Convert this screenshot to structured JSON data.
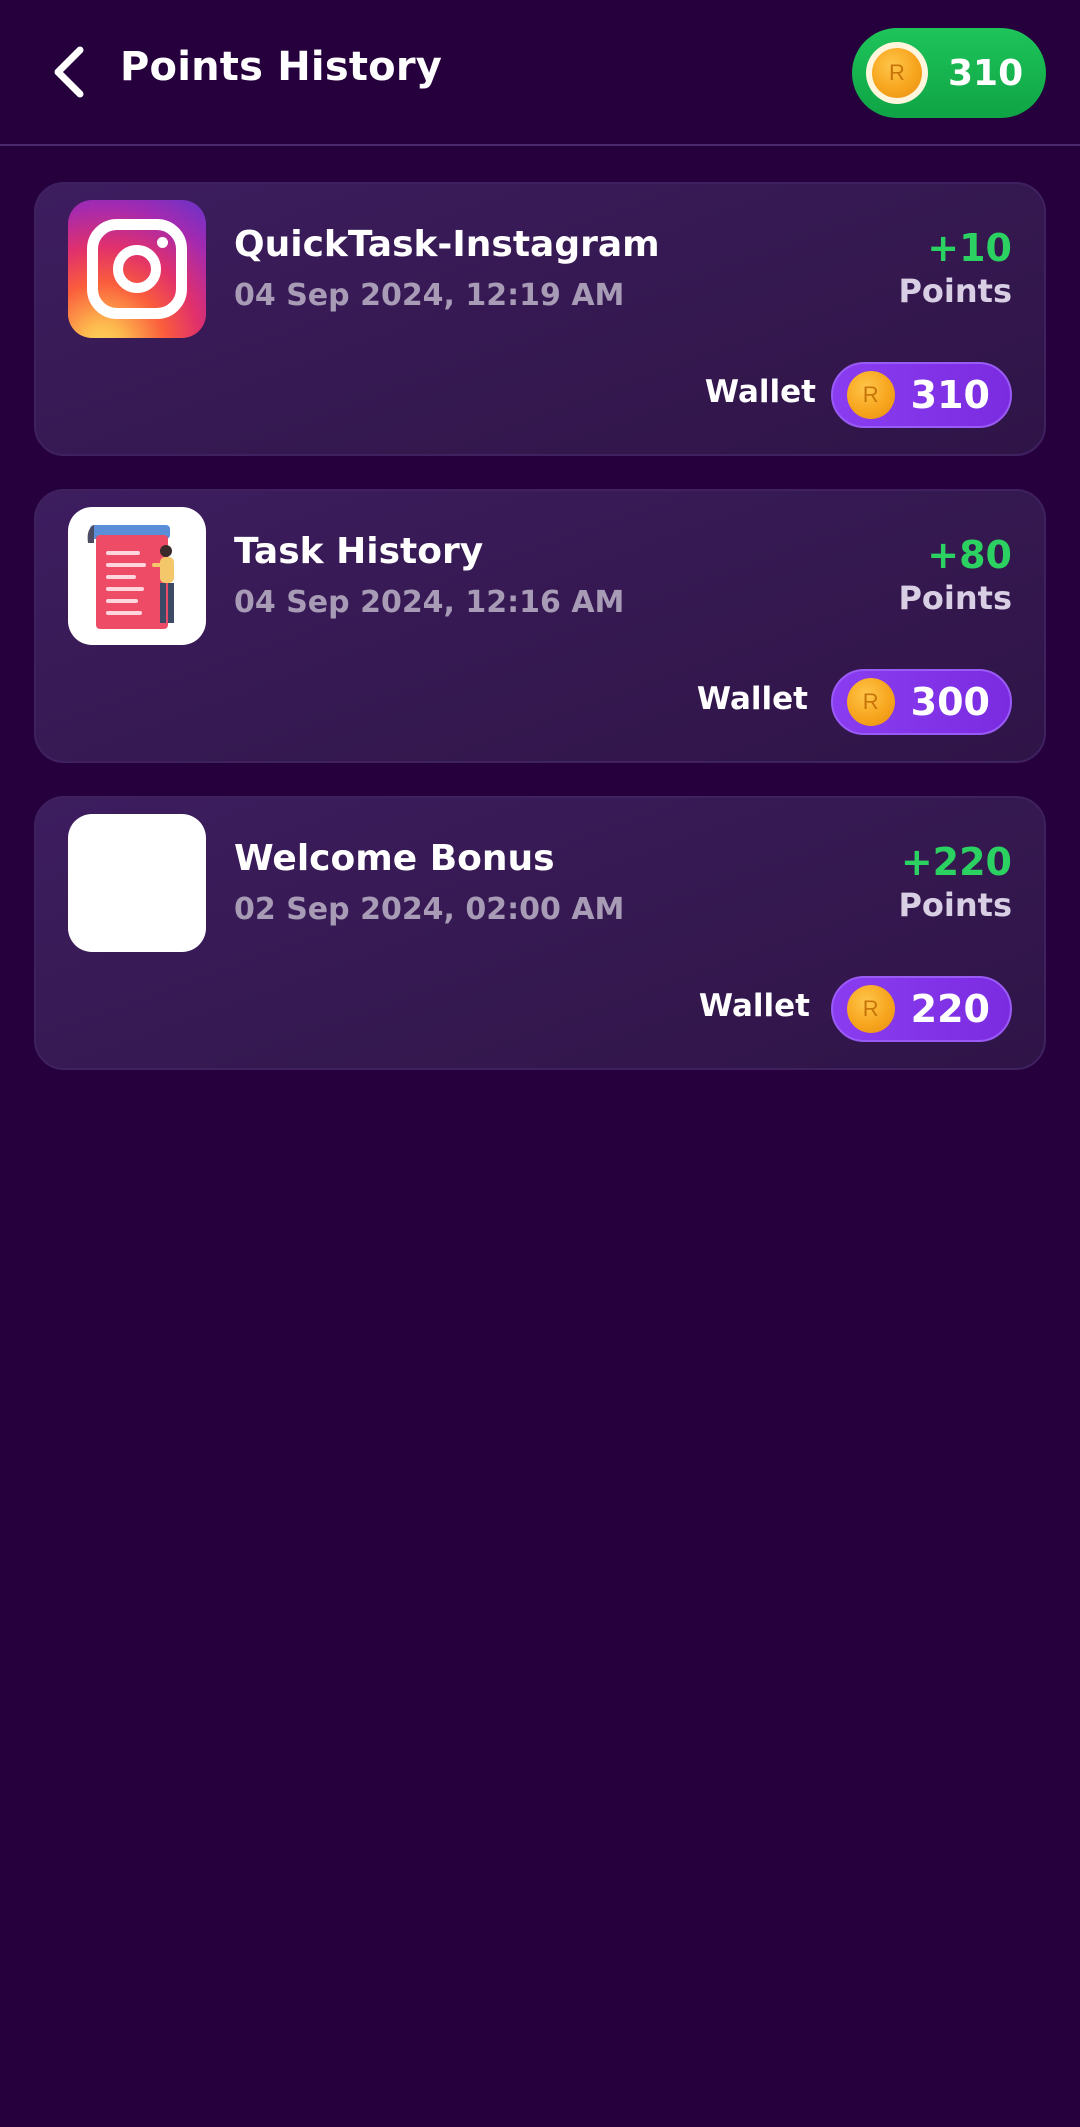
{
  "header": {
    "title": "Points History",
    "balance": "310",
    "coin_symbol": "R"
  },
  "history": [
    {
      "title": "QuickTask-Instagram",
      "date": "04 Sep 2024, 12:19 AM",
      "points": "+10",
      "points_unit": "Points",
      "wallet_label": "Wallet",
      "wallet_value": "310",
      "icon": "instagram-logo"
    },
    {
      "title": "Task History",
      "date": "04 Sep 2024, 12:16 AM",
      "points": "+80",
      "points_unit": "Points",
      "wallet_label": "Wallet",
      "wallet_value": "300",
      "icon": "task-list-illustration"
    },
    {
      "title": "Welcome Bonus",
      "date": "02 Sep 2024, 02:00 AM",
      "points": "+220",
      "points_unit": "Points",
      "wallet_label": "Wallet",
      "wallet_value": "220",
      "icon": "blank-thumbnail"
    }
  ],
  "colors": {
    "background": "#26003c",
    "card": "#3a1b5a",
    "positive": "#2bd161",
    "balance_pill": "#16b54f",
    "wallet_pill": "#8a3df0",
    "coin": "#f7a51e"
  }
}
